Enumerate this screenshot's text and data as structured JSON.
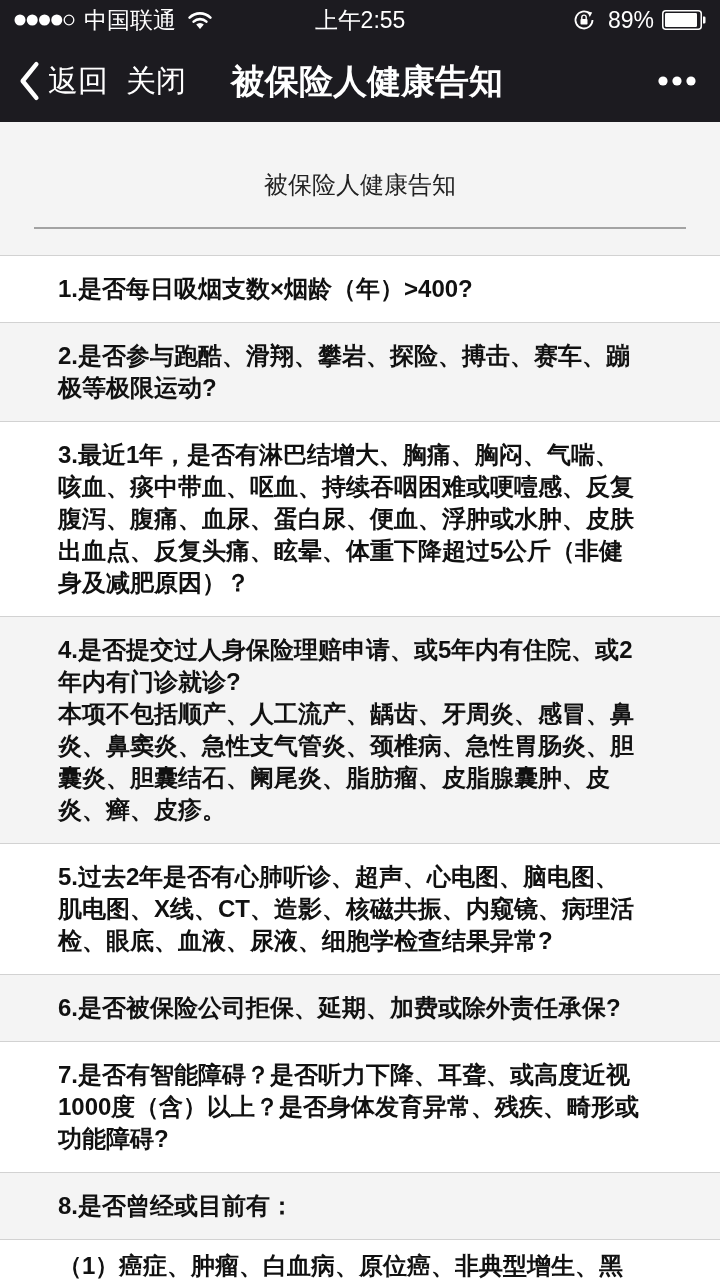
{
  "status_bar": {
    "carrier": "中国联通",
    "time": "上午2:55",
    "battery": "89%"
  },
  "nav_bar": {
    "back": "返回",
    "close": "关闭",
    "title": "被保险人健康告知"
  },
  "header": {
    "title": "被保险人健康告知"
  },
  "questions": [
    {
      "text": "1.是否每日吸烟支数×烟龄（年）>400?"
    },
    {
      "text": "2.是否参与跑酷、滑翔、攀岩、探险、搏击、赛车、蹦极等极限运动?"
    },
    {
      "text": "3.最近1年，是否有淋巴结增大、胸痛、胸闷、气喘、咳血、痰中带血、呕血、持续吞咽困难或哽噎感、反复腹泻、腹痛、血尿、蛋白尿、便血、浮肿或水肿、皮肤出血点、反复头痛、眩晕、体重下降超过5公斤（非健身及减肥原因）？"
    },
    {
      "text": "4.是否提交过人身保险理赔申请、或5年内有住院、或2年内有门诊就诊?",
      "note": "本项不包括顺产、人工流产、龋齿、牙周炎、感冒、鼻炎、鼻窦炎、急性支气管炎、颈椎病、急性胃肠炎、胆囊炎、胆囊结石、阑尾炎、脂肪瘤、皮脂腺囊肿、皮炎、癣、皮疹。"
    },
    {
      "text": "5.过去2年是否有心肺听诊、超声、心电图、脑电图、肌电图、X线、CT、造影、核磁共振、内窥镜、病理活检、眼底、血液、尿液、细胞学检查结果异常?"
    },
    {
      "text": "6.是否被保险公司拒保、延期、加费或除外责任承保?"
    },
    {
      "text": "7.是否有智能障碍？是否听力下降、耳聋、或高度近视1000度（含）以上？是否身体发育异常、残疾、畸形或功能障碍?"
    },
    {
      "text": "8.是否曾经或目前有："
    }
  ],
  "sub_items": [
    {
      "text": "（1）癌症、肿瘤、白血病、原位癌、非典型增生、黑"
    }
  ]
}
